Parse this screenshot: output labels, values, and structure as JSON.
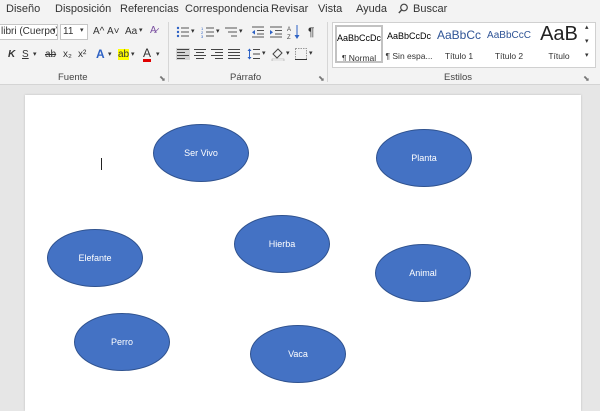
{
  "menu": {
    "design": "Diseño",
    "layout": "Disposición",
    "references": "Referencias",
    "mailings": "Correspondencia",
    "review": "Revisar",
    "view": "Vista",
    "help": "Ayuda",
    "search": "Buscar"
  },
  "font_group": {
    "font_name": "libri (Cuerpo)",
    "font_size": "11",
    "label": "Fuente",
    "grow": "A^",
    "shrink": "A˅",
    "change_case": "Aa",
    "italic": "K",
    "underline": "S",
    "strike": "ab",
    "subscript": "x₂",
    "superscript": "x²",
    "effects": "A",
    "highlight": "ab",
    "font_color": "A"
  },
  "paragraph_group": {
    "label": "Párrafo",
    "pilcrow": "¶"
  },
  "styles_group": {
    "label": "Estilos",
    "items": [
      {
        "sample": "AaBbCcDc",
        "name": "¶ Normal"
      },
      {
        "sample": "AaBbCcDc",
        "name": "¶ Sin espa..."
      },
      {
        "sample": "AaBbCc",
        "name": "Título 1"
      },
      {
        "sample": "AaBbCcC",
        "name": "Título 2"
      },
      {
        "sample": "AaB",
        "name": "Título"
      }
    ]
  },
  "shapes": [
    {
      "label": "Ser Vivo"
    },
    {
      "label": "Planta"
    },
    {
      "label": "Hierba"
    },
    {
      "label": "Elefante"
    },
    {
      "label": "Animal"
    },
    {
      "label": "Perro"
    },
    {
      "label": "Vaca"
    }
  ],
  "colors": {
    "shape_fill": "#4472c4",
    "shape_border": "#2f528f"
  }
}
